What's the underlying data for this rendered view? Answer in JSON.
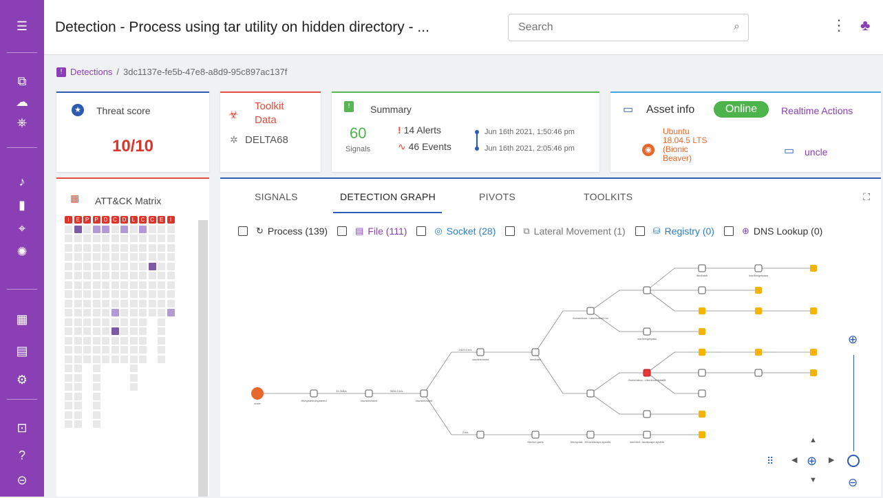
{
  "header": {
    "title": "Detection - Process using tar utility on hidden directory - ...",
    "search_placeholder": "Search"
  },
  "breadcrumb": {
    "root": "Detections",
    "separator": "/",
    "id": "3dc1137e-fe5b-47e8-a8d9-95c897ac137f"
  },
  "threat": {
    "label": "Threat score",
    "value": "10/10"
  },
  "toolkit": {
    "line1": "Toolkit",
    "line2": "Data",
    "host": "DELTA68"
  },
  "summary": {
    "label": "Summary",
    "signals_count": "60",
    "signals_label": "Signals",
    "alerts": "14 Alerts",
    "events": "46 Events",
    "start": "Jun 16th 2021, 1:50:46 pm",
    "end": "Jun 16th 2021, 2:05:46 pm"
  },
  "asset": {
    "label": "Asset info",
    "status": "Online",
    "realtime": "Realtime Actions",
    "os_lines": [
      "Ubuntu",
      "18.04.5 LTS",
      "(Bionic",
      "Beaver)"
    ],
    "host": "uncle"
  },
  "matrix": {
    "title": "ATT&CK Matrix"
  },
  "tabs": [
    {
      "label": "SIGNALS",
      "active": false
    },
    {
      "label": "DETECTION GRAPH",
      "active": true
    },
    {
      "label": "PIVOTS",
      "active": false
    },
    {
      "label": "TOOLKITS",
      "active": false
    }
  ],
  "filters": [
    {
      "label": "Process (139)",
      "icon": "refresh-icon",
      "color": "#333333"
    },
    {
      "label": "File (111)",
      "icon": "file-icon",
      "color": "#8a3fb5"
    },
    {
      "label": "Socket (28)",
      "icon": "socket-icon",
      "color": "#2a7fc0"
    },
    {
      "label": "Lateral Movement (1)",
      "icon": "lateral-icon",
      "color": "#777777"
    },
    {
      "label": "Registry (0)",
      "icon": "registry-icon",
      "color": "#2a7fc0"
    },
    {
      "label": "DNS Lookup (0)",
      "icon": "dns-icon",
      "color": "#333333"
    }
  ],
  "colors": {
    "sidebar": "#8a3fb5",
    "threat_red": "#d9352b",
    "online_green": "#4cb44a",
    "accent_blue": "#2d5bb3",
    "node_orange": "#f4b400",
    "root_orange": "#e8672a"
  },
  "graph": {
    "root_label": "uncle",
    "labels": [
      "/lib/systemd/systemd",
      "/usr/sbin/sshd",
      "/usr/sbin/sshd",
      "/usr/sbin/sshd",
      "/bin/bash",
      "/home/ubun...ubuntu/test2.sh",
      "/usr/bin/getpass",
      "/home/ubun...Ubuntu/d/delta68",
      "/bin/bash",
      "/usr/bin/getpass",
      "/bin/run-parts",
      "/etc/updat...50-landscape-sysinfo",
      "/usr/bin/l...landscape-sysinfo"
    ],
    "edge_labels": [
      "11.2kB/s",
      "3526.0 b/s",
      "2429.0 b/s",
      "2 b/s"
    ]
  }
}
